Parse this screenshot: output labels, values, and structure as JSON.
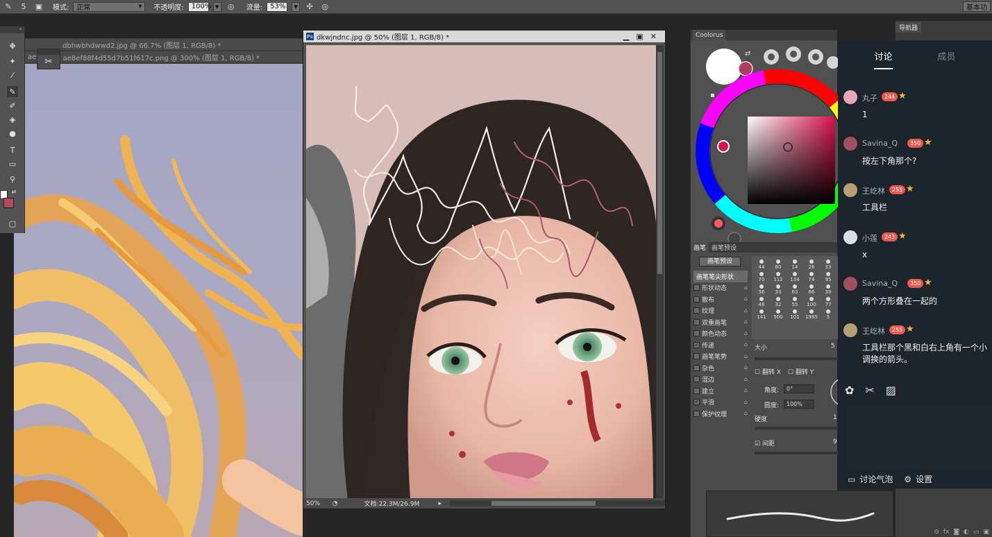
{
  "options_bar": {
    "mode_label": "模式:",
    "mode_value": "正常",
    "opacity_label": "不透明度:",
    "opacity_value": "100%",
    "flow_label": "流量:",
    "flow_value": "53%",
    "brush_size": "5",
    "workspace": "基本功"
  },
  "documents": {
    "back_tab_1": "dbhwbhdwwd2.jpg @ 66.7% (图层 1, RGB/8) *",
    "back_tab_2": "ae8ef88f4d55d7b51f617c.png @ 300% (图层 1, RGB/8) *",
    "back_tab_2_prefix": "ae0",
    "main_title": "dkwjndnc.jpg @ 50% (图层 1, RGB/8) *",
    "main_zoom": "50%",
    "main_doc_info": "文档:22.3M/26.9M"
  },
  "panels": {
    "coolorus_tab": "Coolorus",
    "navigator_tab": "导航器",
    "brush_tab": "画笔",
    "brush_presets_tab": "画笔预设",
    "brush_presets_button": "画笔预设",
    "brush_options": [
      {
        "label": "画笔笔尖形状",
        "checked": false,
        "active": true
      },
      {
        "label": "形状动态",
        "checked": false,
        "active": false
      },
      {
        "label": "散布",
        "checked": false,
        "active": false
      },
      {
        "label": "纹理",
        "checked": false,
        "active": false
      },
      {
        "label": "双重画笔",
        "checked": false,
        "active": false
      },
      {
        "label": "颜色动态",
        "checked": false,
        "active": false
      },
      {
        "label": "传递",
        "checked": true,
        "active": false
      },
      {
        "label": "画笔笔势",
        "checked": false,
        "active": false
      },
      {
        "label": "杂色",
        "checked": false,
        "active": false
      },
      {
        "label": "湿边",
        "checked": false,
        "active": false
      },
      {
        "label": "建立",
        "checked": false,
        "active": false
      },
      {
        "label": "平滑",
        "checked": true,
        "active": false
      },
      {
        "label": "保护纹理",
        "checked": false,
        "active": false
      }
    ],
    "brush_sizes": [
      "44",
      "60",
      "14",
      "26",
      "33",
      "70",
      "112",
      "134",
      "74",
      "95",
      "36",
      "33",
      "63",
      "66",
      "39",
      "48",
      "32",
      "55",
      "100",
      "77",
      "141",
      "500",
      "101",
      "1985",
      "5"
    ],
    "size_label": "大小",
    "size_value": "5",
    "flip_x": "翻转 X",
    "flip_y": "翻转 Y",
    "angle_label": "角度:",
    "angle_value": "0°",
    "roundness_label": "圆度:",
    "roundness_value": "100%",
    "hardness_label": "硬度",
    "hardness_value": "1",
    "spacing_label": "间距",
    "spacing_value": "9"
  },
  "chat": {
    "tab_discussion": "讨论",
    "tab_members": "成员",
    "messages": [
      {
        "name": "丸子",
        "level": "244",
        "text": "1",
        "avatar_color": "#e8a6b6"
      },
      {
        "name": "Savina_Q",
        "level": "350",
        "text": "按左下角那个?",
        "avatar_color": "#a0505e"
      },
      {
        "name": "王屹林",
        "level": "255",
        "text": "工具栏",
        "avatar_color": "#b9a072"
      },
      {
        "name": "小莲",
        "level": "243",
        "text": "x",
        "avatar_color": "#d8dde6"
      },
      {
        "name": "Savina_Q",
        "level": "350",
        "text": "两个方形叠在一起的",
        "avatar_color": "#a0505e"
      },
      {
        "name": "王屹林",
        "level": "255",
        "text": "工具栏那个黑和白右上角有一个小",
        "text2": "调换的箭头。",
        "avatar_color": "#b9a072"
      }
    ],
    "footer_bubble": "讨论气泡",
    "footer_settings": "设置"
  },
  "colors": {
    "foreground": "#ffffff",
    "background": "#b04a5e",
    "picked": "#b33b63"
  }
}
